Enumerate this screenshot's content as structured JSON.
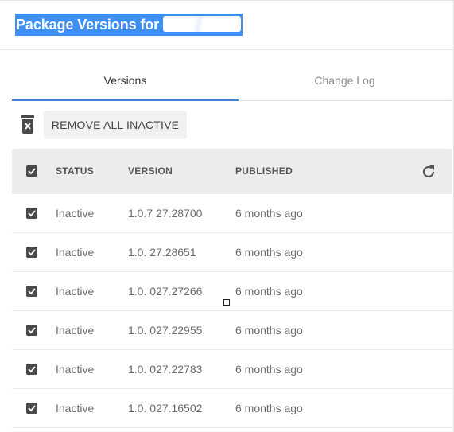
{
  "header": {
    "title": "Package Versions for "
  },
  "tabs": [
    {
      "label": "Versions",
      "active": true
    },
    {
      "label": "Change Log",
      "active": false
    }
  ],
  "toolbar": {
    "remove_label": "REMOVE ALL INACTIVE",
    "icon": "trash-icon"
  },
  "table": {
    "columns": [
      "STATUS",
      "VERSION",
      "PUBLISHED"
    ],
    "select_all_checked": true,
    "rows": [
      {
        "checked": true,
        "status": "Inactive",
        "version": "1.0.7 27.28700",
        "published": "6 months ago"
      },
      {
        "checked": true,
        "status": "Inactive",
        "version": "1.0.  27.28651",
        "published": "6 months ago"
      },
      {
        "checked": true,
        "status": "Inactive",
        "version": "1.0.  027.27266",
        "published": "6 months ago"
      },
      {
        "checked": true,
        "status": "Inactive",
        "version": "1.0.  027.22955",
        "published": "6 months ago"
      },
      {
        "checked": true,
        "status": "Inactive",
        "version": "1.0.  027.22783",
        "published": "6 months ago"
      },
      {
        "checked": true,
        "status": "Inactive",
        "version": "1.0.  027.16502",
        "published": "6 months ago"
      }
    ]
  },
  "colors": {
    "title_highlight": "#3d8ff2",
    "tab_indicator": "#3d7fd6",
    "header_bg": "#ececec"
  }
}
